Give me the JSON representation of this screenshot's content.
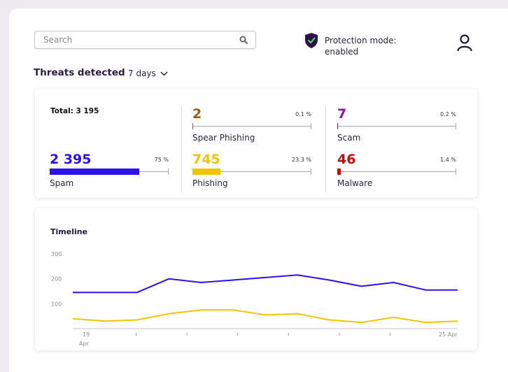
{
  "search": {
    "placeholder": "Search",
    "icon": "search-icon"
  },
  "protection": {
    "text": "Protection mode: enabled",
    "icon": "shield-check-icon",
    "color": "#2f1245",
    "check_color": "#3ee87a"
  },
  "user": {
    "icon": "user-icon"
  },
  "threats": {
    "title": "Threats detected",
    "range": "7 days",
    "total": "Total: 3 195",
    "stats": [
      {
        "id": "spam",
        "value": "2 395",
        "pct": "75 %",
        "fraction": 0.75,
        "label": "Spam",
        "color": "#2a12ef"
      },
      {
        "id": "spear",
        "value": "2",
        "pct": "0.1 %",
        "fraction": 0.001,
        "label": "Spear Phishing",
        "color": "#9b5a12"
      },
      {
        "id": "phishing",
        "value": "745",
        "pct": "23.3 %",
        "fraction": 0.233,
        "label": "Phishing",
        "color": "#f4c400"
      },
      {
        "id": "scam",
        "value": "7",
        "pct": "0.2 %",
        "fraction": 0.002,
        "label": "Scam",
        "color": "#8b14b8"
      },
      {
        "id": "malware",
        "value": "46",
        "pct": "1.4 %",
        "fraction": 0.014,
        "label": "Malware",
        "color": "#c10e0e"
      }
    ]
  },
  "timeline": {
    "title": "Timeline"
  },
  "chart_data": {
    "type": "line",
    "title": "Timeline",
    "y_ticks": [
      "300",
      "200",
      "100"
    ],
    "ylim": [
      0,
      300
    ],
    "x_labels": [
      "19\nApr",
      "",
      "",
      "",
      "",
      "",
      "",
      "25 Apr"
    ],
    "x_first_label": [
      "19",
      "Apr"
    ],
    "x_last_label": "25 Apr",
    "series": [
      {
        "color": "#2a12ef",
        "values": [
          145,
          145,
          145,
          200,
          185,
          195,
          205,
          215,
          195,
          170,
          185,
          155,
          155
        ]
      },
      {
        "color": "#f4c400",
        "values": [
          40,
          30,
          35,
          60,
          75,
          75,
          55,
          60,
          35,
          25,
          45,
          25,
          30
        ]
      }
    ]
  }
}
